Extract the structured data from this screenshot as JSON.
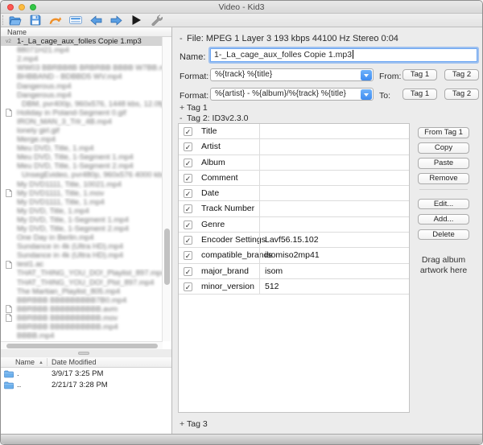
{
  "window": {
    "title": "Video - Kid3"
  },
  "toolbar": {
    "icons": [
      "open",
      "save",
      "revert",
      "select-all",
      "previous-file",
      "next-file",
      "play",
      "settings"
    ]
  },
  "file_list": {
    "header": "Name",
    "items": [
      {
        "text": "1-_La_cage_aux_folles Copie 1.mp3",
        "selected": true,
        "marker": "v2",
        "blurred": false,
        "icon": false,
        "indent": false
      },
      {
        "text": "88071H21.mp4",
        "blurred": true,
        "icon": false,
        "indent": false
      },
      {
        "text": "2.mp4",
        "blurred": true,
        "icon": false,
        "indent": false
      },
      {
        "text": "WW03 BBRBB8B BRBRBB BBBB W7BB.mp4",
        "blurred": true,
        "icon": false,
        "indent": false
      },
      {
        "text": "BHBBAND - BDBBD5 WV.mp4",
        "blurred": true,
        "icon": false,
        "indent": false
      },
      {
        "text": "Dangerous.mp4",
        "blurred": true,
        "icon": false,
        "indent": false
      },
      {
        "text": "Dangerous.mp4",
        "blurred": true,
        "icon": false,
        "indent": false
      },
      {
        "text": "DBM, pvr400p, 960x576, 1448 kbs, 12.0fp",
        "blurred": true,
        "icon": false,
        "indent": true
      },
      {
        "text": "Holiday in Poland-Segment 0.gif",
        "blurred": true,
        "icon": true,
        "indent": false
      },
      {
        "text": "IRON_MAN_3_Trlr_4B.mp4",
        "blurred": true,
        "icon": false,
        "indent": false
      },
      {
        "text": "lonely girl.gif",
        "blurred": true,
        "icon": false,
        "indent": false
      },
      {
        "text": "Merge.mp4",
        "blurred": true,
        "icon": false,
        "indent": false
      },
      {
        "text": "Meu DVD, Title, 1.mp4",
        "blurred": true,
        "icon": false,
        "indent": false
      },
      {
        "text": "Meu DVD, Title, 1-Segment 1.mp4",
        "blurred": true,
        "icon": false,
        "indent": false
      },
      {
        "text": "Meu DVD, Title, 1-Segment 2.mp4",
        "blurred": true,
        "icon": false,
        "indent": false
      },
      {
        "text": "UnsegEvideo, pvr480p, 960x576 4000 kbs,",
        "blurred": true,
        "icon": false,
        "indent": true
      },
      {
        "text": "My DVD1111, Title, 10021.mp4",
        "blurred": true,
        "icon": false,
        "indent": false
      },
      {
        "text": "My DVD1111, Title, 1.mov",
        "blurred": true,
        "icon": true,
        "indent": false
      },
      {
        "text": "My DVD1111, Title, 1.mp4",
        "blurred": true,
        "icon": false,
        "indent": false
      },
      {
        "text": "My DVD, Title, 1.mp4",
        "blurred": true,
        "icon": false,
        "indent": false
      },
      {
        "text": "My DVD, Title, 1-Segment 1.mp4",
        "blurred": true,
        "icon": false,
        "indent": false
      },
      {
        "text": "My DVD, Title, 1-Segment 2.mp4",
        "blurred": true,
        "icon": false,
        "indent": false
      },
      {
        "text": "One Day in Berlin.mp4",
        "blurred": true,
        "icon": false,
        "indent": false
      },
      {
        "text": "Sundance in 4k (Ultra HD).mp4",
        "blurred": true,
        "icon": false,
        "indent": false
      },
      {
        "text": "Sundance in 4k (Ultra HD).mp4",
        "blurred": true,
        "icon": false,
        "indent": false
      },
      {
        "text": "test1.ac",
        "blurred": true,
        "icon": true,
        "indent": false
      },
      {
        "text": "THAT_THING_YOU_DO!_Playlist_897.mp4",
        "blurred": true,
        "icon": false,
        "indent": false
      },
      {
        "text": "THAT_THING_YOU_DO!_Plst_897.mp4",
        "blurred": true,
        "icon": false,
        "indent": false
      },
      {
        "text": "The Martian_Playlist_805.mp4",
        "blurred": true,
        "icon": false,
        "indent": false
      },
      {
        "text": "BBRBBB  BBBBBBBBB7B0.mp4",
        "blurred": true,
        "icon": false,
        "indent": false
      },
      {
        "text": "BBRBBB  BBBBBBBBBB.avm",
        "blurred": true,
        "icon": true,
        "indent": false
      },
      {
        "text": "BBRBBB  BBBBBBBBBB.mov",
        "blurred": true,
        "icon": true,
        "indent": false
      },
      {
        "text": "BBRBBB  BBBBBBBBBB.mp4",
        "blurred": true,
        "icon": false,
        "indent": false
      },
      {
        "text": "BBBB.mp4",
        "blurred": true,
        "icon": false,
        "indent": false
      }
    ]
  },
  "dir_list": {
    "name_header": "Name",
    "sort_indicator": "▲",
    "date_header": "Date Modified",
    "rows": [
      {
        "name": ".",
        "date": "3/9/17 3:25 PM"
      },
      {
        "name": "..",
        "date": "2/21/17 3:28 PM"
      }
    ]
  },
  "detail": {
    "file_marker": "-",
    "file_info": "File: MPEG 1 Layer 3 193 kbps 44100 Hz Stereo 0:04",
    "name_label": "Name:",
    "name_value": "1-_La_cage_aux_folles Copie 1.mp3",
    "format_up_label": "Format:↑",
    "format_up_value": "%{track} %{title}",
    "from_label": "From:",
    "format_down_label": "Format:↓",
    "format_down_value": "%{artist} - %{album}/%{track} %{title}",
    "to_label": "To:",
    "tag1_button": "Tag 1",
    "tag2_button": "Tag 2",
    "tag1_marker": "+",
    "tag1_label": "Tag 1",
    "tag2_marker": "-",
    "tag2_label": "Tag 2: ID3v2.3.0",
    "tag3_marker": "+",
    "tag3_label": "Tag 3",
    "checkmark": "✓",
    "fields": [
      {
        "label": "Title",
        "value": "",
        "checked": true
      },
      {
        "label": "Artist",
        "value": "",
        "checked": true
      },
      {
        "label": "Album",
        "value": "",
        "checked": true
      },
      {
        "label": "Comment",
        "value": "",
        "checked": true
      },
      {
        "label": "Date",
        "value": "",
        "checked": true
      },
      {
        "label": "Track Number",
        "value": "",
        "checked": true
      },
      {
        "label": "Genre",
        "value": "",
        "checked": true
      },
      {
        "label": "Encoder Settings",
        "value": "Lavf56.15.102",
        "checked": true
      },
      {
        "label": "compatible_brands",
        "value": "isomiso2mp41",
        "checked": true
      },
      {
        "label": "major_brand",
        "value": "isom",
        "checked": true
      },
      {
        "label": "minor_version",
        "value": "512",
        "checked": true
      }
    ],
    "buttons_top": [
      "From Tag 1",
      "Copy",
      "Paste",
      "Remove"
    ],
    "buttons_bottom": [
      "Edit...",
      "Add...",
      "Delete"
    ],
    "drag_text": "Drag album artwork here"
  },
  "colors": {
    "accent_blue": "#3e8bf0",
    "selection_gray": "#d4d4d4",
    "panel_bg": "#ececec",
    "folder_blue": "#63a9e8",
    "revert_orange": "#f0902c"
  }
}
